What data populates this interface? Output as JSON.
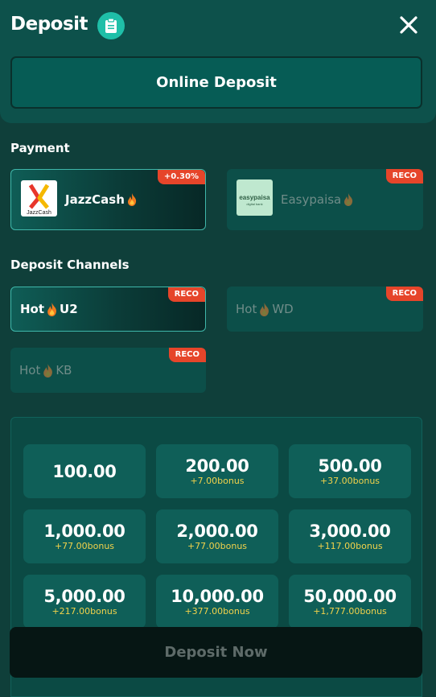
{
  "header": {
    "title": "Deposit",
    "badge_icon": "clipboard-icon",
    "close_icon": "close-icon"
  },
  "online_deposit": {
    "label": "Online Deposit"
  },
  "payment": {
    "section_label": "Payment",
    "methods": [
      {
        "name": "JazzCash",
        "tag": "+0.30%",
        "logo_text": "JazzCash",
        "selected": true
      },
      {
        "name": "Easypaisa",
        "tag": "RECO",
        "logo_text": "easypaisa",
        "logo_subtext": "digital bank",
        "selected": false
      }
    ]
  },
  "channels": {
    "section_label": "Deposit Channels",
    "items": [
      {
        "prefix": "Hot",
        "suffix": "U2",
        "tag": "RECO",
        "selected": true
      },
      {
        "prefix": "Hot",
        "suffix": "WD",
        "tag": "RECO",
        "selected": false
      },
      {
        "prefix": "Hot",
        "suffix": "KB",
        "tag": "RECO",
        "selected": false
      }
    ]
  },
  "amounts": [
    {
      "value": "100.00",
      "bonus": ""
    },
    {
      "value": "200.00",
      "bonus": "+7.00bonus"
    },
    {
      "value": "500.00",
      "bonus": "+37.00bonus"
    },
    {
      "value": "1,000.00",
      "bonus": "+77.00bonus"
    },
    {
      "value": "2,000.00",
      "bonus": "+77.00bonus"
    },
    {
      "value": "3,000.00",
      "bonus": "+117.00bonus"
    },
    {
      "value": "5,000.00",
      "bonus": "+217.00bonus"
    },
    {
      "value": "10,000.00",
      "bonus": "+377.00bonus"
    },
    {
      "value": "50,000.00",
      "bonus": "+1,777.00bonus"
    }
  ],
  "deposit_now": {
    "label": "Deposit Now"
  },
  "colors": {
    "accent": "#1fbfa8",
    "tag": "#e6452a",
    "bonus": "#f2d24b",
    "background": "#0f3f3a"
  }
}
